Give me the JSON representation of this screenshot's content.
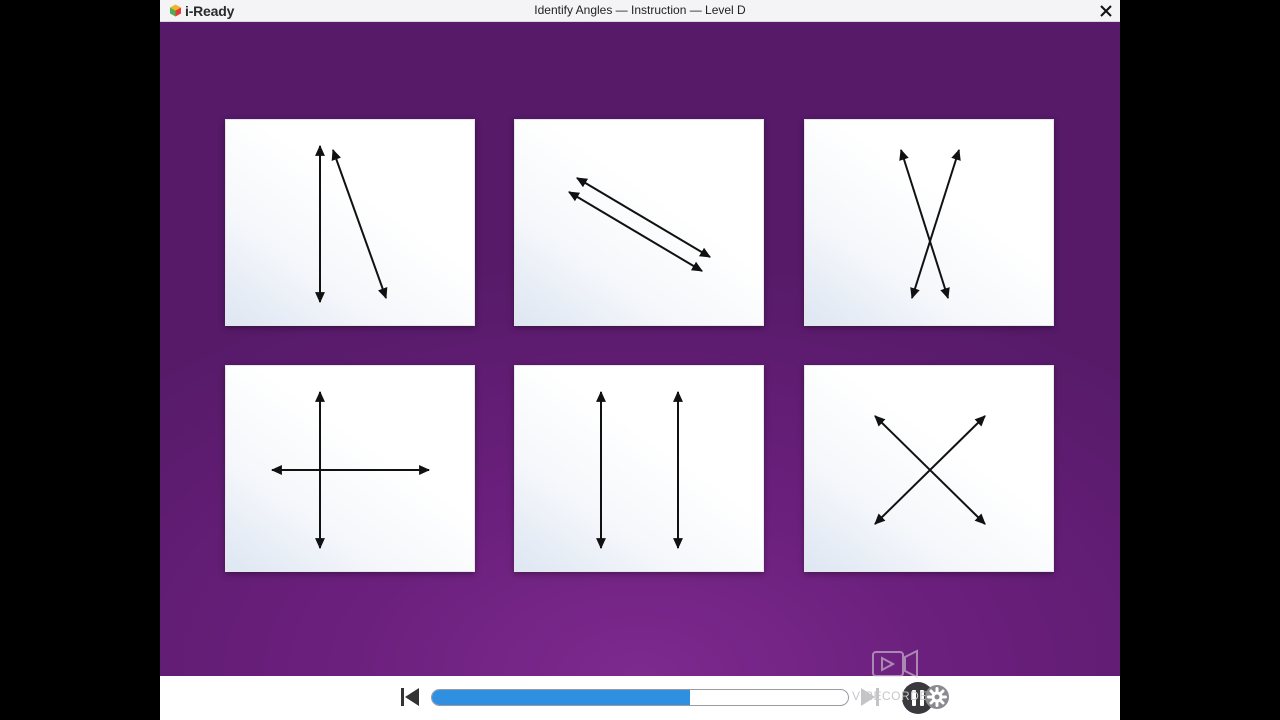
{
  "app": {
    "logo_text": "i-Ready",
    "window_title": "Identify Angles — Instruction — Level D",
    "close_icon": "close-icon"
  },
  "cards": [
    {
      "id": "card-1",
      "figure": "intersecting-lines-narrow-angle"
    },
    {
      "id": "card-2",
      "figure": "parallel-diagonal-lines"
    },
    {
      "id": "card-3",
      "figure": "intersecting-lines-x-tall"
    },
    {
      "id": "card-4",
      "figure": "perpendicular-lines"
    },
    {
      "id": "card-5",
      "figure": "parallel-vertical-lines"
    },
    {
      "id": "card-6",
      "figure": "perpendicular-diagonal-lines"
    }
  ],
  "controls": {
    "progress": 0.62,
    "prev_icon": "skip-back-icon",
    "next_icon": "skip-forward-icon",
    "pause_icon": "pause-icon",
    "settings_icon": "gear-icon",
    "accent_color": "#2f8fe0"
  },
  "watermark": {
    "text": "V RECORDER",
    "icon": "video-camera-icon"
  },
  "colors": {
    "stage": "#6a1f7c",
    "card": "#ffffff",
    "line": "#111111"
  }
}
